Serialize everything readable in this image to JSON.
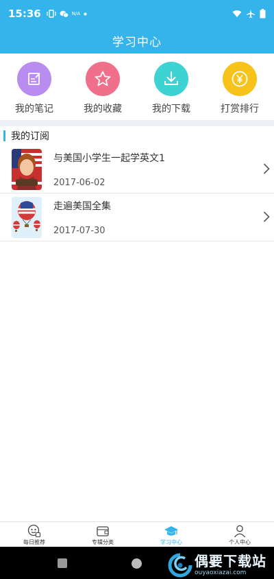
{
  "status_bar": {
    "time": "15:36",
    "network_label": "N/A"
  },
  "header": {
    "title": "学习中心"
  },
  "quick_actions": [
    {
      "label": "我的笔记",
      "icon": "note-edit-icon",
      "color": "#b98cf0"
    },
    {
      "label": "我的收藏",
      "icon": "star-icon",
      "color": "#f06f8a"
    },
    {
      "label": "我的下载",
      "icon": "download-icon",
      "color": "#3ed3d3"
    },
    {
      "label": "打赏排行",
      "icon": "yen-icon",
      "color": "#f7c21a"
    }
  ],
  "subscriptions": {
    "title": "我的订阅",
    "items": [
      {
        "title": "与美国小学生一起学英文1",
        "date": "2017-06-02",
        "thumb": "boy-with-flag-thumb"
      },
      {
        "title": "走遍美国全集",
        "date": "2017-07-30",
        "thumb": "flag-balloons-thumb"
      }
    ]
  },
  "tabbar": {
    "tabs": [
      {
        "label": "每日推荐",
        "icon": "daily-recommend-icon",
        "active": false
      },
      {
        "label": "专辑分类",
        "icon": "wallet-category-icon",
        "active": false
      },
      {
        "label": "学习中心",
        "icon": "graduation-cap-icon",
        "active": true
      },
      {
        "label": "个人中心",
        "icon": "person-icon",
        "active": false
      }
    ]
  },
  "watermark": {
    "main": "偶要下载站",
    "sub": "ouyaoxiazai.com"
  },
  "colors": {
    "accent": "#34b4ea"
  }
}
